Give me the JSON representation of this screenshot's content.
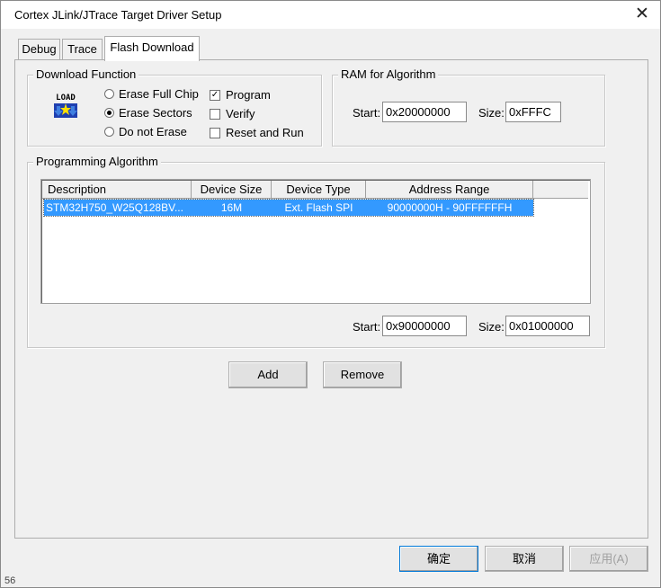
{
  "window": {
    "title": "Cortex JLink/JTrace Target Driver Setup"
  },
  "tabs": [
    {
      "label": "Debug"
    },
    {
      "label": "Trace"
    },
    {
      "label": "Flash Download"
    }
  ],
  "download_function": {
    "title": "Download Function",
    "icon_text": "LOAD",
    "erase_options": [
      {
        "label": "Erase Full Chip",
        "selected": false
      },
      {
        "label": "Erase Sectors",
        "selected": true
      },
      {
        "label": "Do not Erase",
        "selected": false
      }
    ],
    "checks": [
      {
        "label": "Program",
        "checked": true,
        "mark": "✓"
      },
      {
        "label": "Verify",
        "checked": false,
        "mark": ""
      },
      {
        "label": "Reset and Run",
        "checked": false,
        "mark": ""
      }
    ]
  },
  "ram": {
    "title": "RAM for Algorithm",
    "start_label": "Start:",
    "start_value": "0x20000000",
    "size_label": "Size:",
    "size_value": "0xFFFC"
  },
  "programming_algorithm": {
    "title": "Programming Algorithm",
    "columns": [
      "Description",
      "Device Size",
      "Device Type",
      "Address Range"
    ],
    "rows": [
      {
        "description": "STM32H750_W25Q128BV...",
        "device_size": "16M",
        "device_type": "Ext. Flash SPI",
        "address_range": "90000000H - 90FFFFFFH"
      }
    ],
    "start_label": "Start:",
    "start_value": "0x90000000",
    "size_label": "Size:",
    "size_value": "0x01000000"
  },
  "buttons": {
    "add": "Add",
    "remove": "Remove"
  },
  "footer": {
    "ok": "确定",
    "cancel": "取消",
    "apply": "应用(A)"
  },
  "corner_text": "56",
  "colors": {
    "selection": "#3399ff",
    "primary_border": "#0078d7",
    "icon_blue": "#1f3fb0",
    "icon_yellow": "#ffe000"
  }
}
